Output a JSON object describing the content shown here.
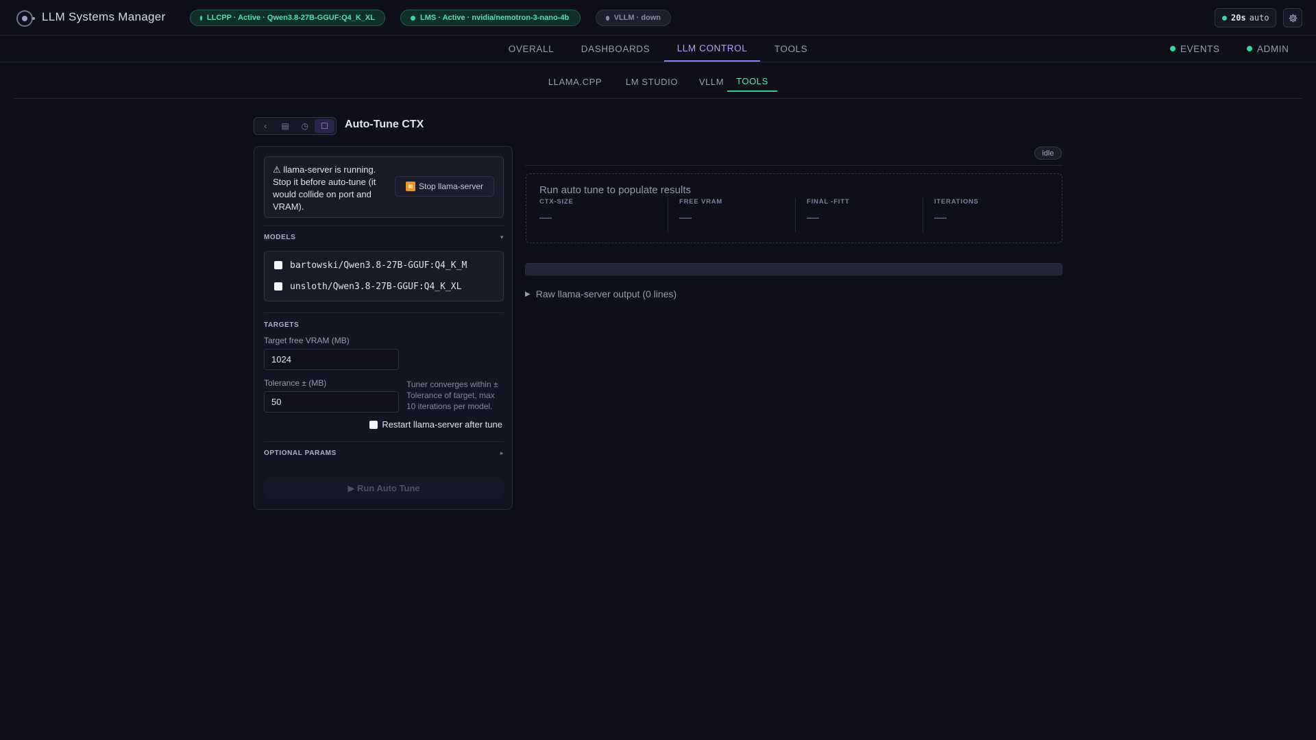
{
  "app": {
    "title": "LLM Systems Manager"
  },
  "status_pills": {
    "llcpp": "LLCPP · Active · Qwen3.8-27B-GGUF:Q4_K_XL",
    "lms": "LMS · Active · nvidia/nemotron-3-nano-4b",
    "vllm": "VLLM · down"
  },
  "refresh": {
    "interval": "20s",
    "mode": "auto"
  },
  "main_nav": {
    "tabs": [
      {
        "label": "OVERALL"
      },
      {
        "label": "DASHBOARDS"
      },
      {
        "label": "LLM CONTROL",
        "active": true
      },
      {
        "label": "TOOLS"
      }
    ],
    "right": [
      {
        "label": "EVENTS"
      },
      {
        "label": "ADMIN"
      }
    ]
  },
  "sub_nav": {
    "tabs": [
      {
        "label": "LLAMA.CPP"
      },
      {
        "label": "LM STUDIO"
      },
      {
        "label": "VLLM"
      },
      {
        "label": "TOOLS",
        "active": true
      }
    ]
  },
  "tool": {
    "title": "Auto-Tune CTX",
    "toolbar_icons": [
      "chevron-left-icon",
      "list-icon",
      "history-icon",
      "panel-icon"
    ]
  },
  "warning": {
    "text": "⚠ llama-server is running. Stop it before auto-tune (it would collide on port and VRAM).",
    "stop_label": "Stop llama-server"
  },
  "models": {
    "heading": "MODELS",
    "items": [
      {
        "name": "bartowski/Qwen3.8-27B-GGUF:Q4_K_M",
        "checked": false
      },
      {
        "name": "unsloth/Qwen3.8-27B-GGUF:Q4_K_XL",
        "checked": false
      }
    ]
  },
  "targets": {
    "heading": "TARGETS",
    "vram_label": "Target free VRAM (MB)",
    "vram_value": "1024",
    "tolerance_label": "Tolerance ± (MB)",
    "tolerance_value": "50",
    "hint": "Tuner converges within ± Tolerance of target, max 10 iterations per model.",
    "restart_label": "Restart llama-server after tune"
  },
  "optional": {
    "heading": "OPTIONAL PARAMS"
  },
  "run_label": "▶ Run Auto Tune",
  "results": {
    "status": "idle",
    "placeholder": "Run auto tune to populate results",
    "metrics": [
      {
        "label": "CTX-SIZE",
        "value": "—"
      },
      {
        "label": "FREE VRAM",
        "value": "—"
      },
      {
        "label": "FINAL -FITT",
        "value": "—"
      },
      {
        "label": "ITERATIONS",
        "value": "—"
      }
    ],
    "progress": 0,
    "raw_output": "Raw llama-server output (0 lines)"
  },
  "colors": {
    "accent_purple": "#8f7cf7",
    "accent_green": "#34c99d",
    "warning_orange": "#e8942a"
  }
}
